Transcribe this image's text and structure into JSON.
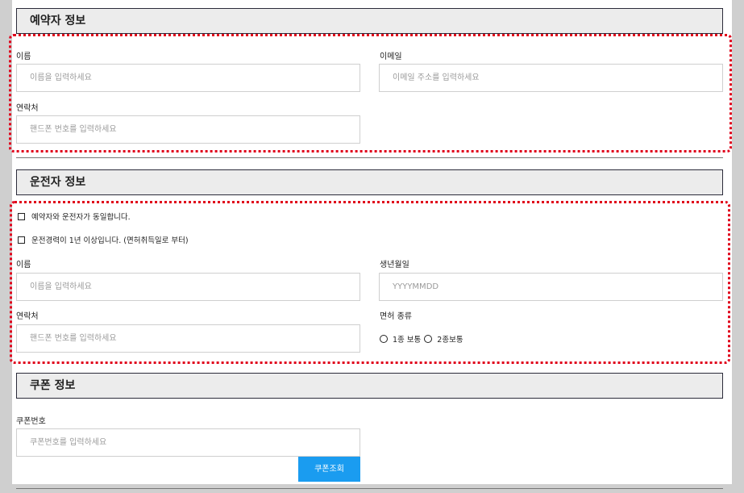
{
  "sections": {
    "booker": {
      "title": "예약자 정보"
    },
    "driver": {
      "title": "운전자 정보"
    },
    "coupon": {
      "title": "쿠폰 정보"
    }
  },
  "booker": {
    "name_label": "이름",
    "name_placeholder": "이름을 입력하세요",
    "email_label": "이메일",
    "email_placeholder": "이메일 주소를 입력하세요",
    "phone_label": "연락처",
    "phone_placeholder": "핸드폰 번호를 입력하세요"
  },
  "driver": {
    "same_as_booker": "예약자와 운전자가 동일합니다.",
    "experience": "운전경력이 1년 이상입니다. (면허취득일로 부터)",
    "name_label": "이름",
    "name_placeholder": "이름을 입력하세요",
    "birth_label": "생년월일",
    "birth_placeholder": "YYYYMMDD",
    "phone_label": "연락처",
    "phone_placeholder": "핸드폰 번호를 입력하세요",
    "license_label": "면허 종류",
    "license_options": [
      "1종 보통",
      "2종보통"
    ]
  },
  "coupon": {
    "number_label": "쿠폰번호",
    "number_placeholder": "쿠폰번호를 입력하세요",
    "lookup_button": "쿠폰조회"
  },
  "colors": {
    "accent": "#1a9cf0",
    "highlight": "#e0001a",
    "header_bg": "#ececec"
  }
}
